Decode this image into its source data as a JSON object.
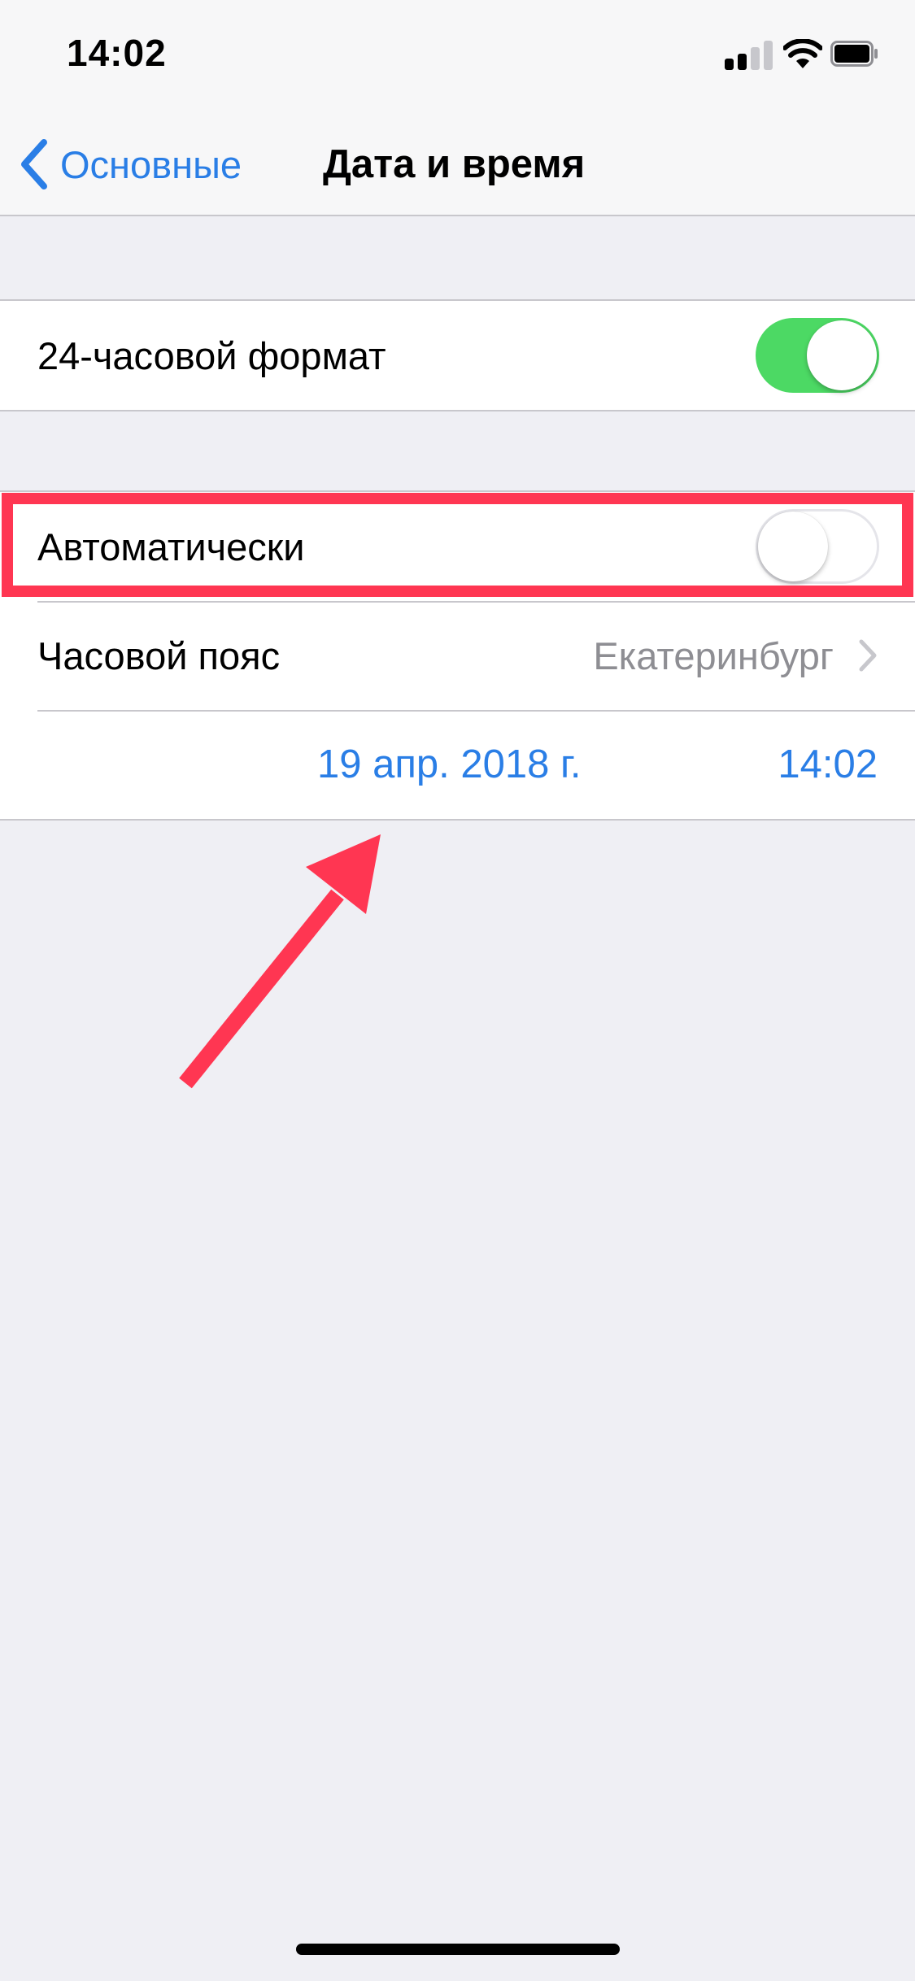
{
  "status_bar": {
    "time": "14:02"
  },
  "nav": {
    "back_label": "Основные",
    "title": "Дата и время"
  },
  "settings": {
    "format_24h": {
      "label": "24-часовой формат",
      "enabled": true
    },
    "automatic": {
      "label": "Автоматически",
      "enabled": false
    },
    "timezone": {
      "label": "Часовой пояс",
      "value": "Екатеринбург"
    },
    "datetime": {
      "date": "19 апр. 2018 г.",
      "time": "14:02"
    }
  },
  "colors": {
    "accent": "#2a7ee6",
    "toggle_on": "#4cd964",
    "annotation": "#ff3652",
    "background": "#efeff4"
  }
}
